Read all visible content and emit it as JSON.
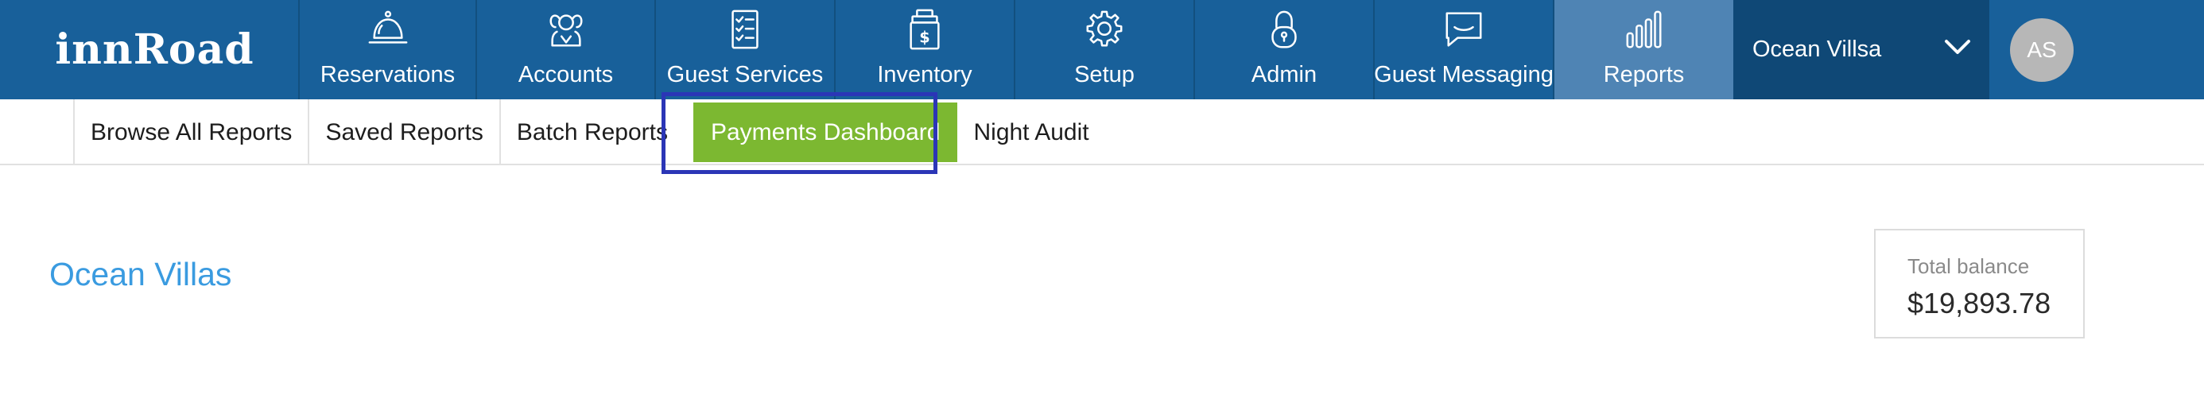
{
  "brand": {
    "logo_text": "innRoad"
  },
  "nav": {
    "items": [
      {
        "label": "Reservations",
        "icon": "bell-icon"
      },
      {
        "label": "Accounts",
        "icon": "people-icon"
      },
      {
        "label": "Guest Services",
        "icon": "checklist-icon"
      },
      {
        "label": "Inventory",
        "icon": "inventory-icon"
      },
      {
        "label": "Setup",
        "icon": "gear-icon"
      },
      {
        "label": "Admin",
        "icon": "lock-icon"
      },
      {
        "label": "Guest Messaging",
        "icon": "message-icon"
      },
      {
        "label": "Reports",
        "icon": "bar-chart-icon",
        "active": true
      }
    ],
    "property_selector": "Ocean Villsa",
    "avatar_initials": "AS"
  },
  "subnav": {
    "items": [
      {
        "label": "Browse All Reports"
      },
      {
        "label": "Saved Reports"
      },
      {
        "label": "Batch Reports"
      },
      {
        "label": "Payments Dashboard",
        "active": true
      },
      {
        "label": "Night Audit"
      }
    ]
  },
  "main": {
    "property_title": "Ocean Villas",
    "balance": {
      "label": "Total balance",
      "value": "$19,893.78"
    }
  },
  "colors": {
    "nav_bg": "#18609a",
    "nav_active": "#4f84b4",
    "property_select_bg": "#0f4876",
    "subnav_active": "#7cb831",
    "title_blue": "#3a9be0",
    "highlight_box": "#2b36b6"
  }
}
